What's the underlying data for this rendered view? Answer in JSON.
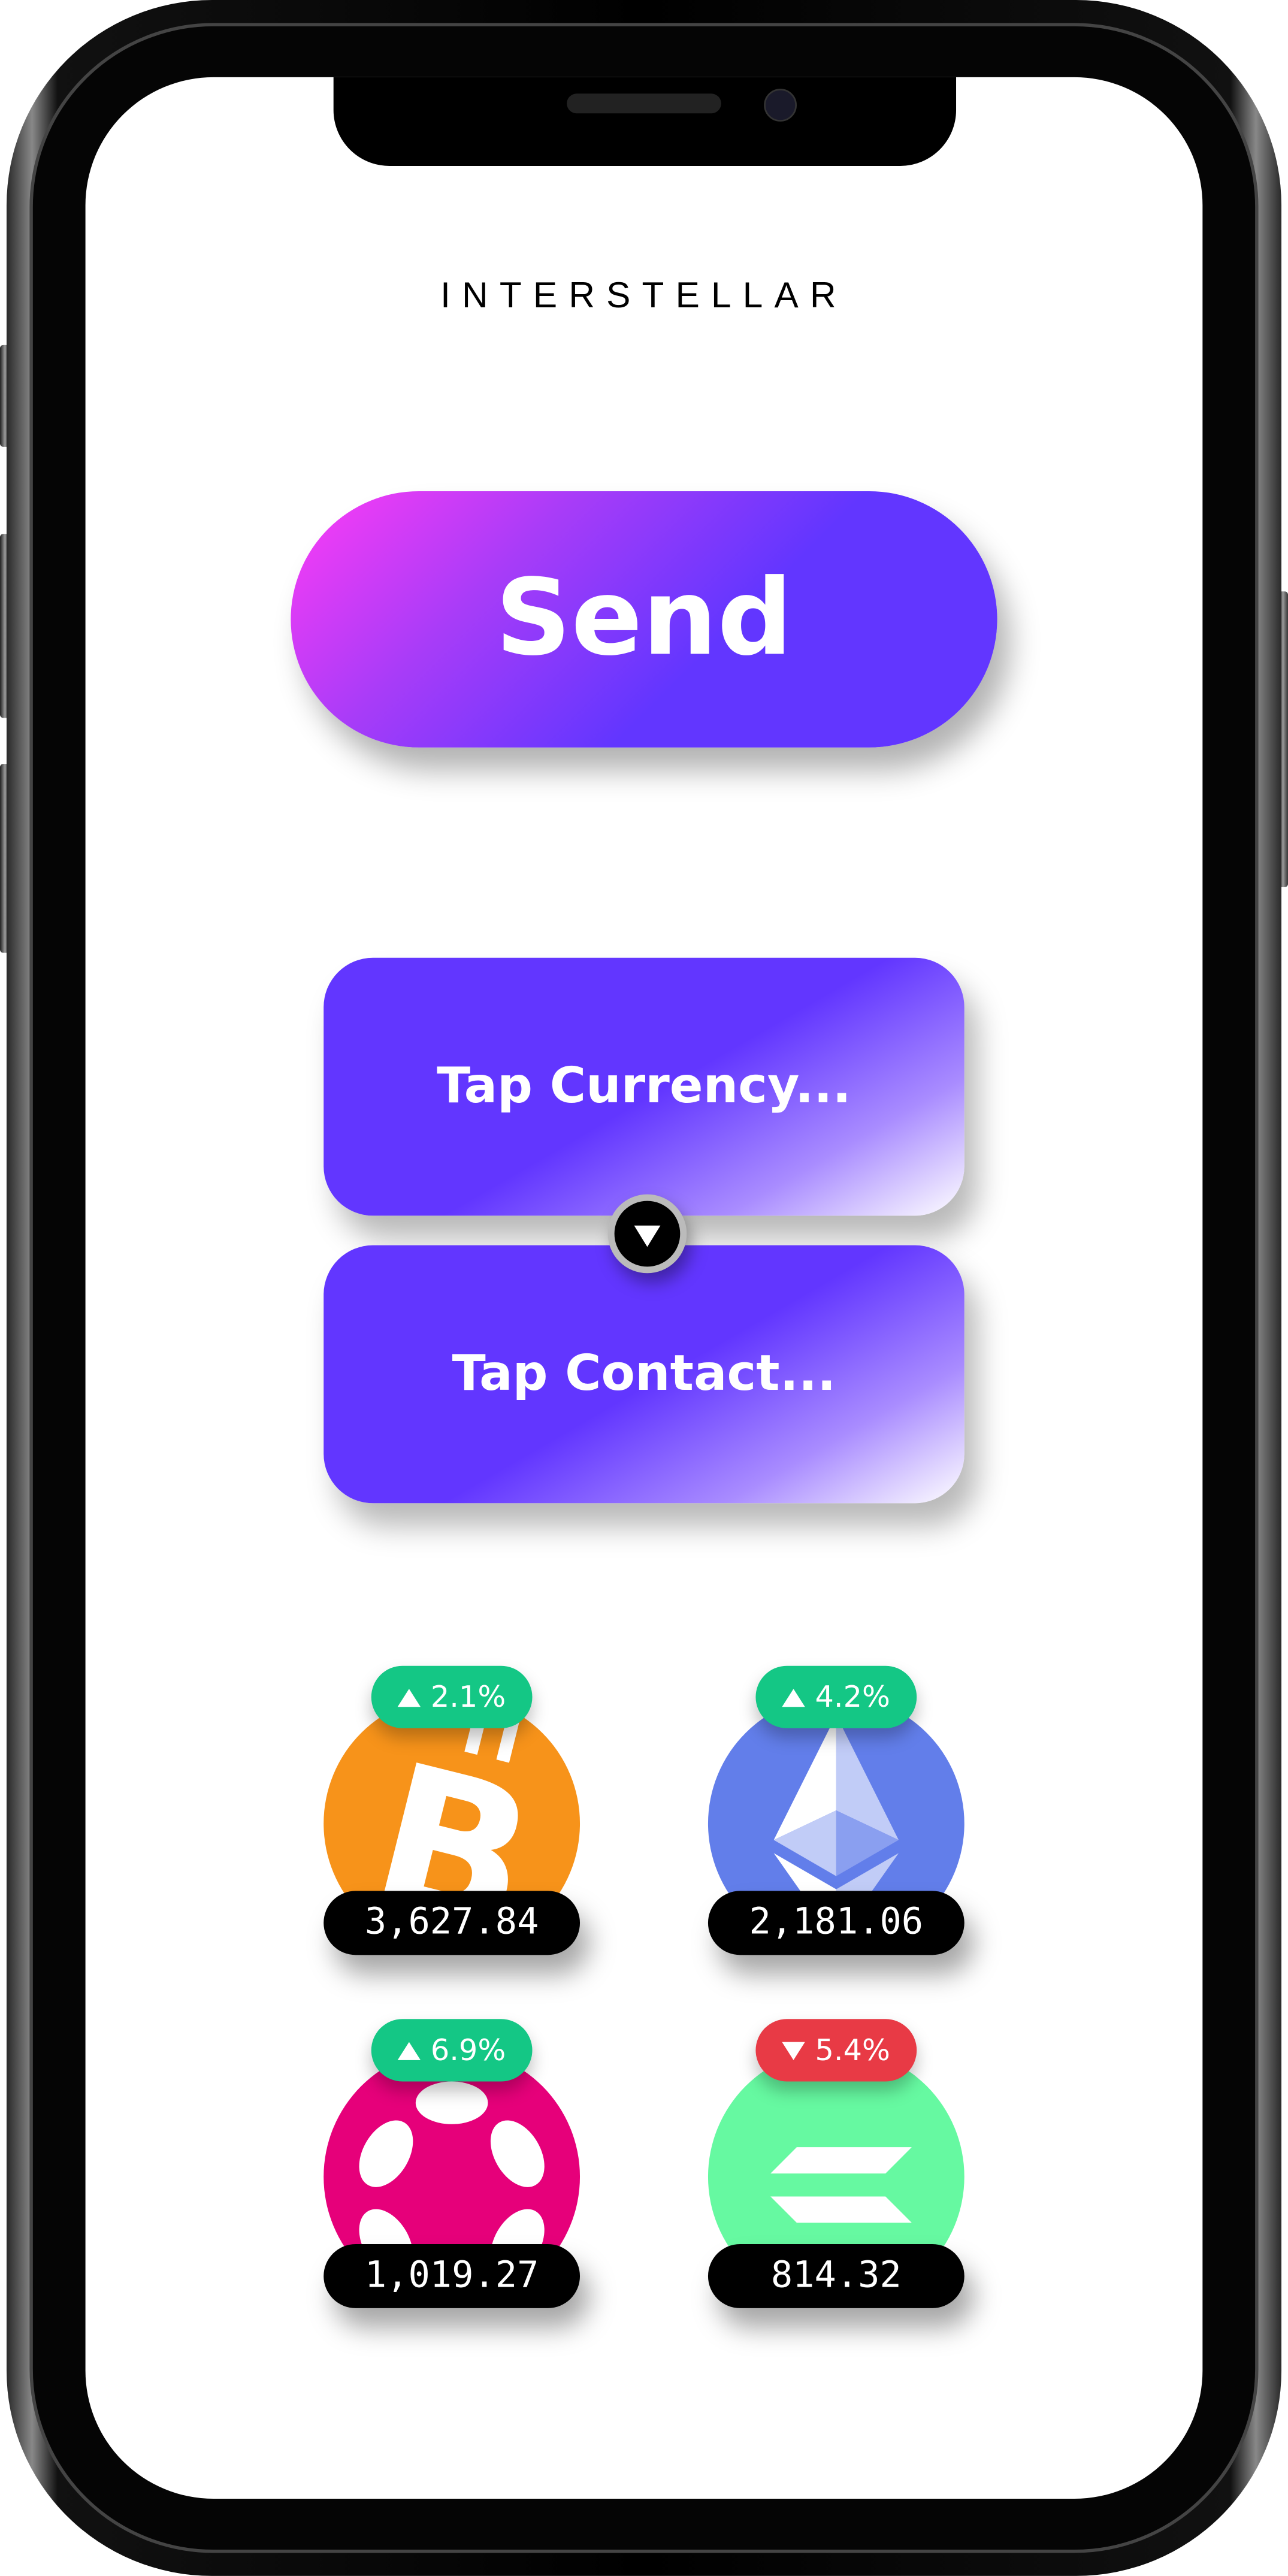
{
  "app": {
    "logo": "INTERSTELLAR"
  },
  "send_button": {
    "label": "Send"
  },
  "currency_selector": {
    "placeholder": "Tap Currency..."
  },
  "contact_selector": {
    "placeholder": "Tap Contact..."
  },
  "coins": [
    {
      "name": "bitcoin",
      "change": "2.1%",
      "direction": "up",
      "price": "3,627.84",
      "color": "#f7931a"
    },
    {
      "name": "ethereum",
      "change": "4.2%",
      "direction": "up",
      "price": "2,181.06",
      "color": "#627eea"
    },
    {
      "name": "polkadot",
      "change": "6.9%",
      "direction": "up",
      "price": "1,019.27",
      "color": "#e6007a"
    },
    {
      "name": "solana",
      "change": "5.4%",
      "direction": "down",
      "price": "814.32",
      "color": "#66f9a1"
    }
  ],
  "colors": {
    "up": "#14c785",
    "down": "#e83a45",
    "accent": "#6236ff",
    "accent2": "#ff3cf5"
  }
}
